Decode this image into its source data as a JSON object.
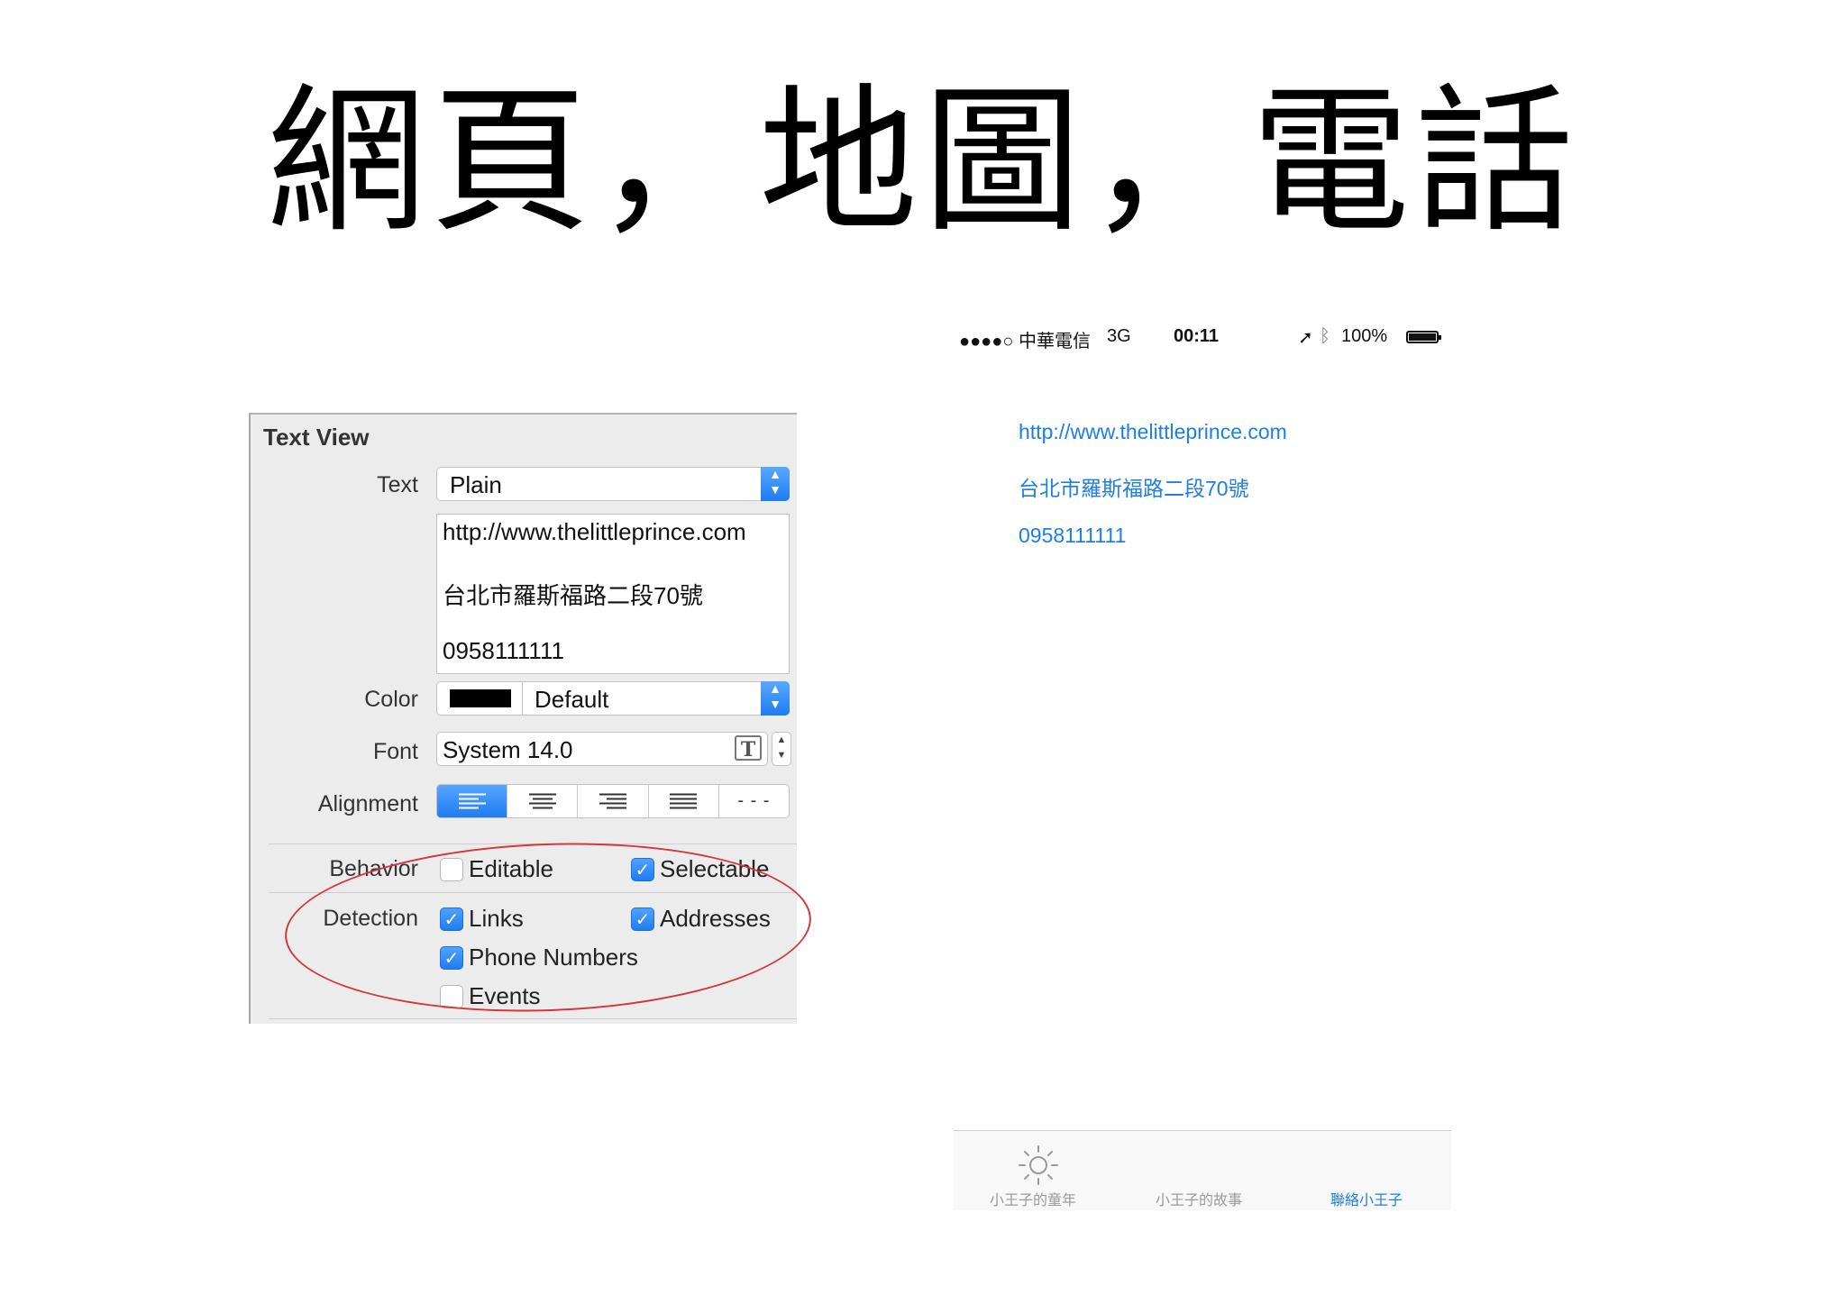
{
  "slide": {
    "title": "網頁，地圖，電話"
  },
  "inspector": {
    "section_title": "Text View",
    "text_label": "Text",
    "text_value": "Plain",
    "text_lines": [
      "http://www.thelittleprince.com",
      "台北市羅斯福路二段70號",
      "0958111111"
    ],
    "color_label": "Color",
    "color_value": "Default",
    "font_label": "Font",
    "font_value": "System 14.0",
    "alignment_label": "Alignment",
    "alignment_options": [
      "left-align-icon",
      "center-align-icon",
      "right-align-icon",
      "justify-align-icon",
      "natural-align-icon"
    ],
    "behavior_label": "Behavior",
    "behavior": [
      {
        "label": "Editable",
        "checked": false
      },
      {
        "label": "Selectable",
        "checked": true
      }
    ],
    "detection_label": "Detection",
    "detection": [
      {
        "label": "Links",
        "checked": true
      },
      {
        "label": "Addresses",
        "checked": true
      },
      {
        "label": "Phone Numbers",
        "checked": true
      },
      {
        "label": "Events",
        "checked": false
      }
    ],
    "highlight_color": "#d4363a",
    "accent_color": "#1f7cf2"
  },
  "phone": {
    "status": {
      "carrier": "●●●●○ 中華電信",
      "network": "3G",
      "time": "00:11",
      "battery": "100%",
      "icons": [
        "location-arrow-icon",
        "bluetooth-icon",
        "battery-icon"
      ]
    },
    "links": [
      "http://www.thelittleprince.com",
      "台北市羅斯福路二段70號",
      "0958111111"
    ],
    "link_color": "#1e7ee8",
    "tabs": [
      {
        "label": "小王子的童年",
        "icon": "sun-icon",
        "active": false
      },
      {
        "label": "小王子的故事",
        "icon": "",
        "active": false
      },
      {
        "label": "聯絡小王子",
        "icon": "",
        "active": true
      }
    ]
  }
}
